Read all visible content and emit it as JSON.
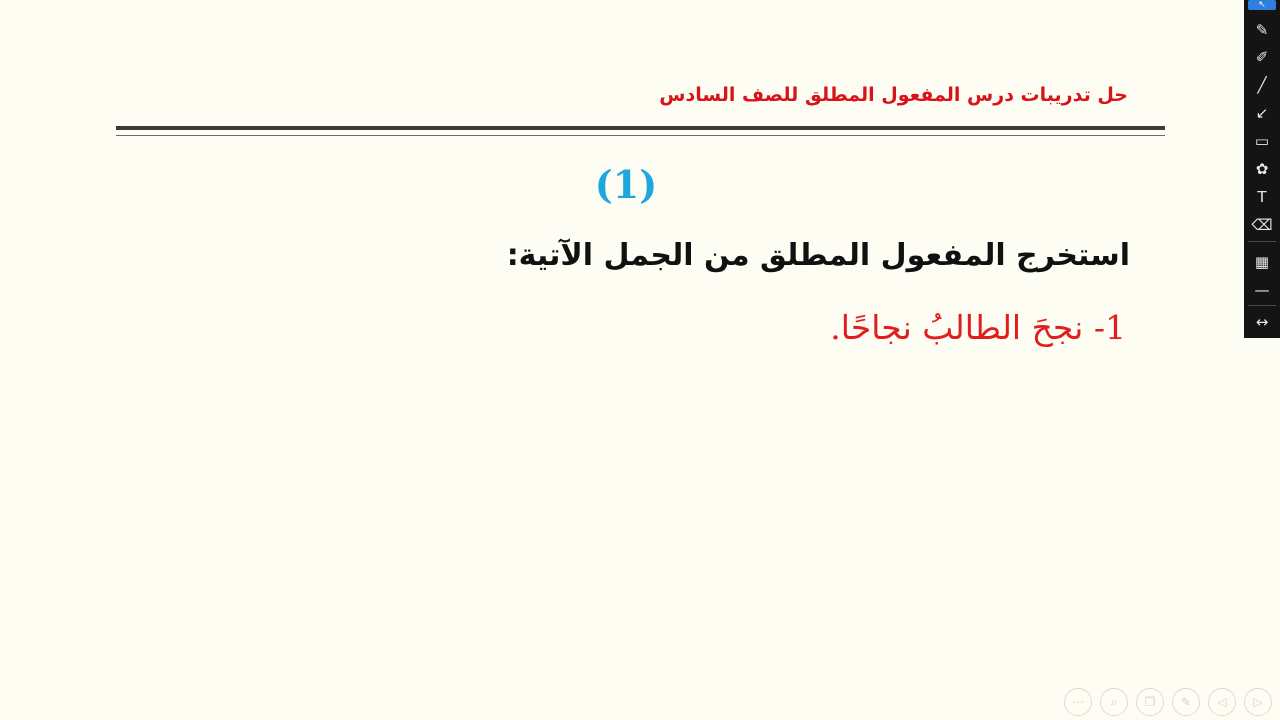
{
  "slide": {
    "header_title": "حل تدريبات درس المفعول المطلق للصف السادس",
    "number_label": "(1)",
    "instruction": "استخرج المفعول المطلق من الجمل الآتية:",
    "item_1": "1- نجحَ الطالبُ نجاحًا."
  },
  "colors": {
    "header_red": "#d8141b",
    "number_blue": "#1ea6dd",
    "item_red": "#e01e1e",
    "background": "#fdfdf3"
  },
  "toolbar": {
    "tools": [
      {
        "icon": "cursor-icon",
        "glyph": "↖"
      },
      {
        "icon": "pencil-icon",
        "glyph": "✎"
      },
      {
        "icon": "marker-icon",
        "glyph": "✐"
      },
      {
        "icon": "line-icon",
        "glyph": "╱"
      },
      {
        "icon": "arrow-pen-icon",
        "glyph": "↙"
      },
      {
        "icon": "rectangle-icon",
        "glyph": "▭"
      },
      {
        "icon": "color-palette-icon",
        "glyph": "✿"
      },
      {
        "icon": "text-tool-icon",
        "glyph": "T"
      },
      {
        "icon": "eraser-icon",
        "glyph": "⌫"
      },
      {
        "icon": "transparency-icon",
        "glyph": "▦"
      },
      {
        "icon": "line-width-icon",
        "glyph": "—"
      },
      {
        "icon": "expand-arrows-icon",
        "glyph": "↔"
      }
    ]
  },
  "nav": {
    "buttons": [
      {
        "icon": "more-icon",
        "glyph": "⋯"
      },
      {
        "icon": "zoom-icon",
        "glyph": "⌕"
      },
      {
        "icon": "copy-slides-icon",
        "glyph": "❐"
      },
      {
        "icon": "pen-icon",
        "glyph": "✎"
      },
      {
        "icon": "previous-icon",
        "glyph": "◁"
      },
      {
        "icon": "next-icon",
        "glyph": "▷"
      }
    ]
  }
}
